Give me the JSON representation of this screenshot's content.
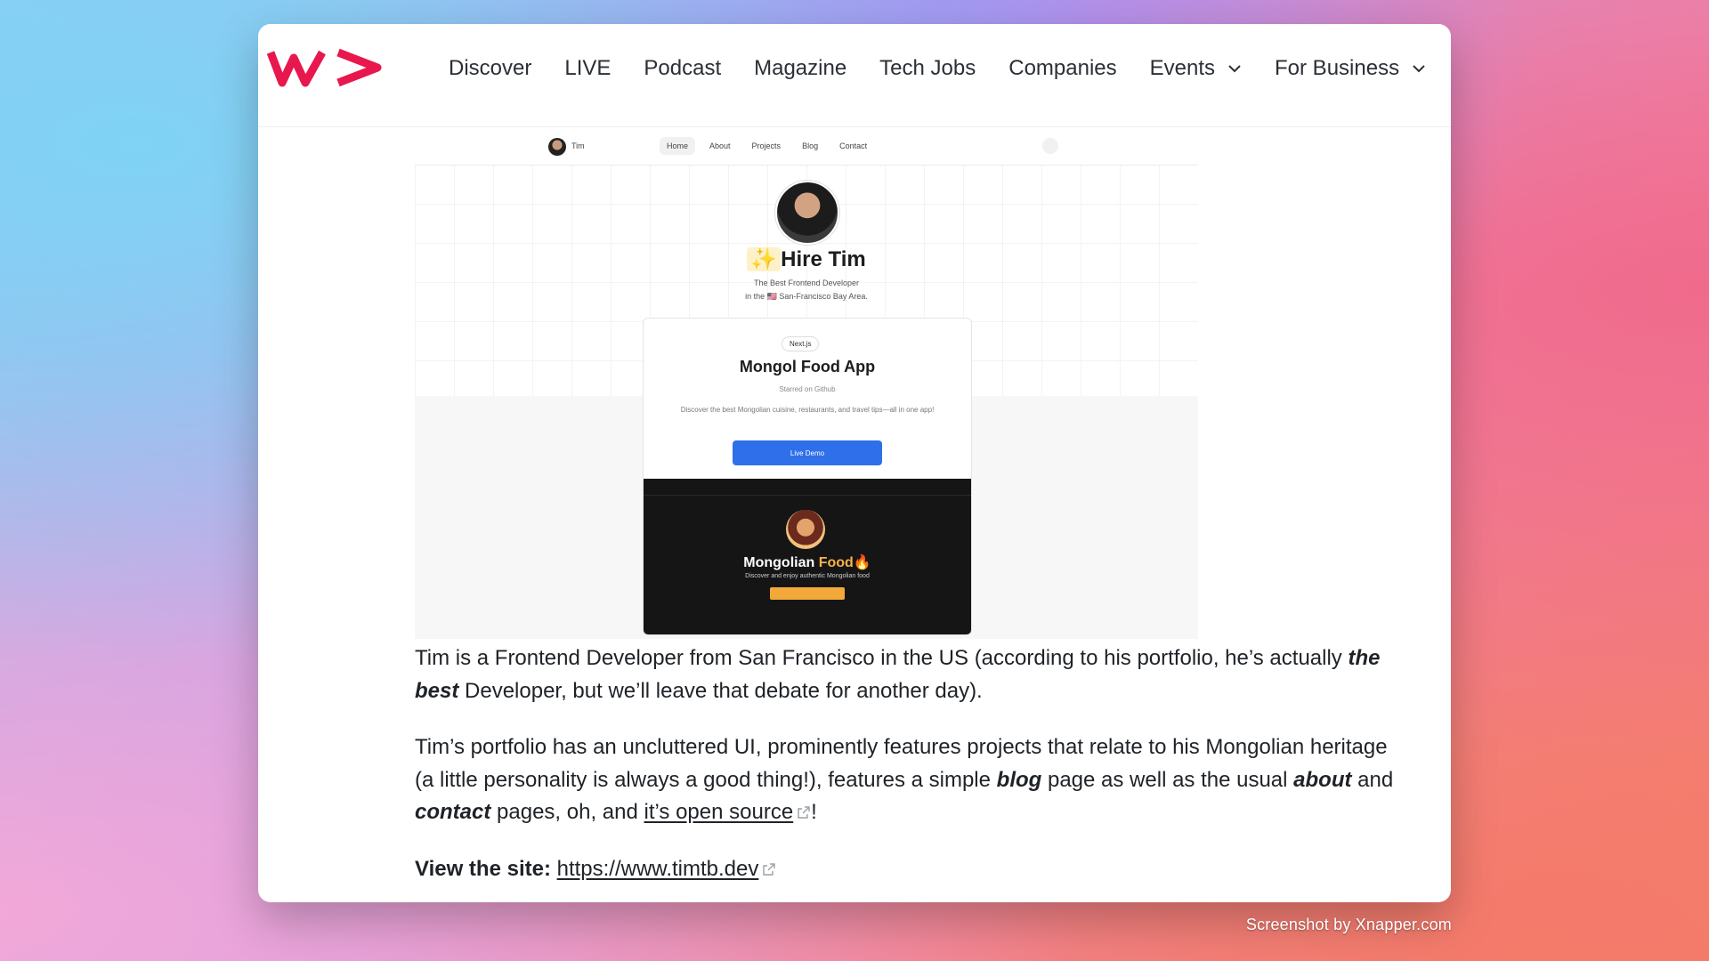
{
  "nav": {
    "items": [
      {
        "label": "Discover"
      },
      {
        "label": "LIVE"
      },
      {
        "label": "Podcast"
      },
      {
        "label": "Magazine"
      },
      {
        "label": "Tech Jobs"
      },
      {
        "label": "Companies"
      },
      {
        "label": "Events",
        "dropdown": true
      },
      {
        "label": "For Business",
        "dropdown": true
      }
    ]
  },
  "preview": {
    "nav_name": "Tim",
    "nav_links": [
      "Home",
      "About",
      "Projects",
      "Blog",
      "Contact"
    ],
    "hero_title": "Hire Tim",
    "hero_tagline_1": "The Best Frontend Developer",
    "hero_tagline_2": "in the 🇺🇸 San-Francisco Bay Area.",
    "card_pill": "Next.js",
    "card_title": "Mongol Food App",
    "card_star": "Starred on Github",
    "card_desc": "Discover the best Mongolian cuisine, restaurants, and travel tips—all in one app!",
    "card_button": "Live Demo",
    "app_title_1": "Mongolian",
    "app_title_2": "Food",
    "app_subtitle": "Discover and enjoy authentic Mongolian food"
  },
  "article": {
    "p1_a": "Tim is a Frontend Developer from San Francisco in the US (according to his portfolio, he’s actually ",
    "p1_em": "the best",
    "p1_b": " Developer, but we’ll leave that debate for another day).",
    "p2_a": "Tim’s portfolio has an uncluttered UI, prominently features projects that relate to his Mongolian heritage (a little personality is always a good thing!), features a simple ",
    "p2_blog": "blog",
    "p2_b": " page as well as the usual ",
    "p2_about": "about",
    "p2_c": " and ",
    "p2_contact": "contact",
    "p2_d": " pages, oh, and ",
    "p2_link": "it’s open source",
    "p2_e": "!",
    "p3_label": "View the site: ",
    "p3_link": "https://www.timtb.dev"
  },
  "credit": "Screenshot by Xnapper.com",
  "colors": {
    "brand": "#e8174d",
    "primary_button": "#2f6fe9"
  }
}
